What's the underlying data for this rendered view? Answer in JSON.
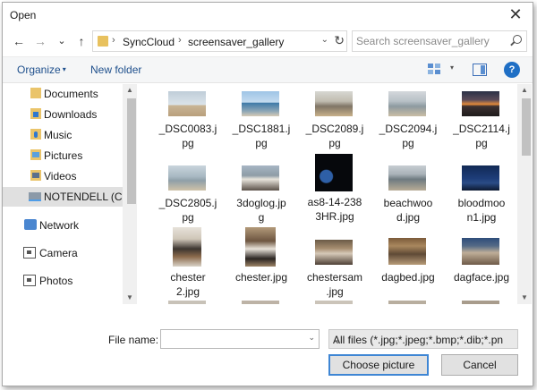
{
  "window": {
    "title": "Open",
    "close_glyph": "✕"
  },
  "nav": {
    "back_glyph": "←",
    "forward_glyph": "→",
    "recent_glyph": "⌄",
    "up_glyph": "↑",
    "breadcrumbs": [
      "SyncCloud",
      "screensaver_gallery"
    ],
    "separator": "›",
    "dropdown_glyph": "⌄",
    "refresh_glyph": "↻",
    "search_placeholder": "Search screensaver_gallery"
  },
  "toolbar": {
    "organize": "Organize",
    "organize_caret": "▾",
    "new_folder": "New folder",
    "view_caret": "▾",
    "help": "?"
  },
  "sidebar": {
    "items": [
      {
        "label": "Documents",
        "icon": "documents-icon"
      },
      {
        "label": "Downloads",
        "icon": "downloads-icon"
      },
      {
        "label": "Music",
        "icon": "music-icon"
      },
      {
        "label": "Pictures",
        "icon": "pictures-icon"
      },
      {
        "label": "Videos",
        "icon": "videos-icon"
      },
      {
        "label": "NOTENDELL (C:)",
        "icon": "drive-icon",
        "selected": true
      },
      {
        "label": "Network",
        "icon": "network-icon"
      },
      {
        "label": "Camera",
        "icon": "camera-folder-icon"
      },
      {
        "label": "Photos",
        "icon": "photos-folder-icon"
      }
    ]
  },
  "files": [
    {
      "name": "_DSC0083.jpg"
    },
    {
      "name": "_DSC1881.jpg"
    },
    {
      "name": "_DSC2089.jpg"
    },
    {
      "name": "_DSC2094.jpg"
    },
    {
      "name": "_DSC2114.jpg"
    },
    {
      "name": "_DSC2805.jpg"
    },
    {
      "name": "3doglog.jpg"
    },
    {
      "name": "as8-14-2383HR.jpg"
    },
    {
      "name": "beachwood.jpg"
    },
    {
      "name": "bloodmoon1.jpg"
    },
    {
      "name": "chester2.jpg"
    },
    {
      "name": "chester.jpg"
    },
    {
      "name": "chestersam.jpg"
    },
    {
      "name": "dagbed.jpg"
    },
    {
      "name": "dagface.jpg"
    }
  ],
  "file_labels": [
    [
      "_DSC0083.j",
      "pg"
    ],
    [
      "_DSC1881.j",
      "pg"
    ],
    [
      "_DSC2089.j",
      "pg"
    ],
    [
      "_DSC2094.j",
      "pg"
    ],
    [
      "_DSC2114.j",
      "pg"
    ],
    [
      "_DSC2805.j",
      "pg"
    ],
    [
      "3doglog.jp",
      "g"
    ],
    [
      "as8-14-238",
      "3HR.jpg"
    ],
    [
      "beachwoo",
      "d.jpg"
    ],
    [
      "bloodmoo",
      "n1.jpg"
    ],
    [
      "chester",
      "2.jpg"
    ],
    [
      "chester.jpg"
    ],
    [
      "chestersam",
      ".jpg"
    ],
    [
      "dagbed.jpg"
    ],
    [
      "dagface.jpg"
    ]
  ],
  "footer": {
    "filename_label": "File name:",
    "filename_value": "",
    "filetype": "All files (*.jpg;*.jpeg;*.bmp;*.dib;*.png",
    "open_button": "Choose picture",
    "cancel_button": "Cancel"
  },
  "colors": {
    "accent": "#1f6fc5",
    "link": "#1e4f8c",
    "selected_row": "#e0e0e0"
  }
}
